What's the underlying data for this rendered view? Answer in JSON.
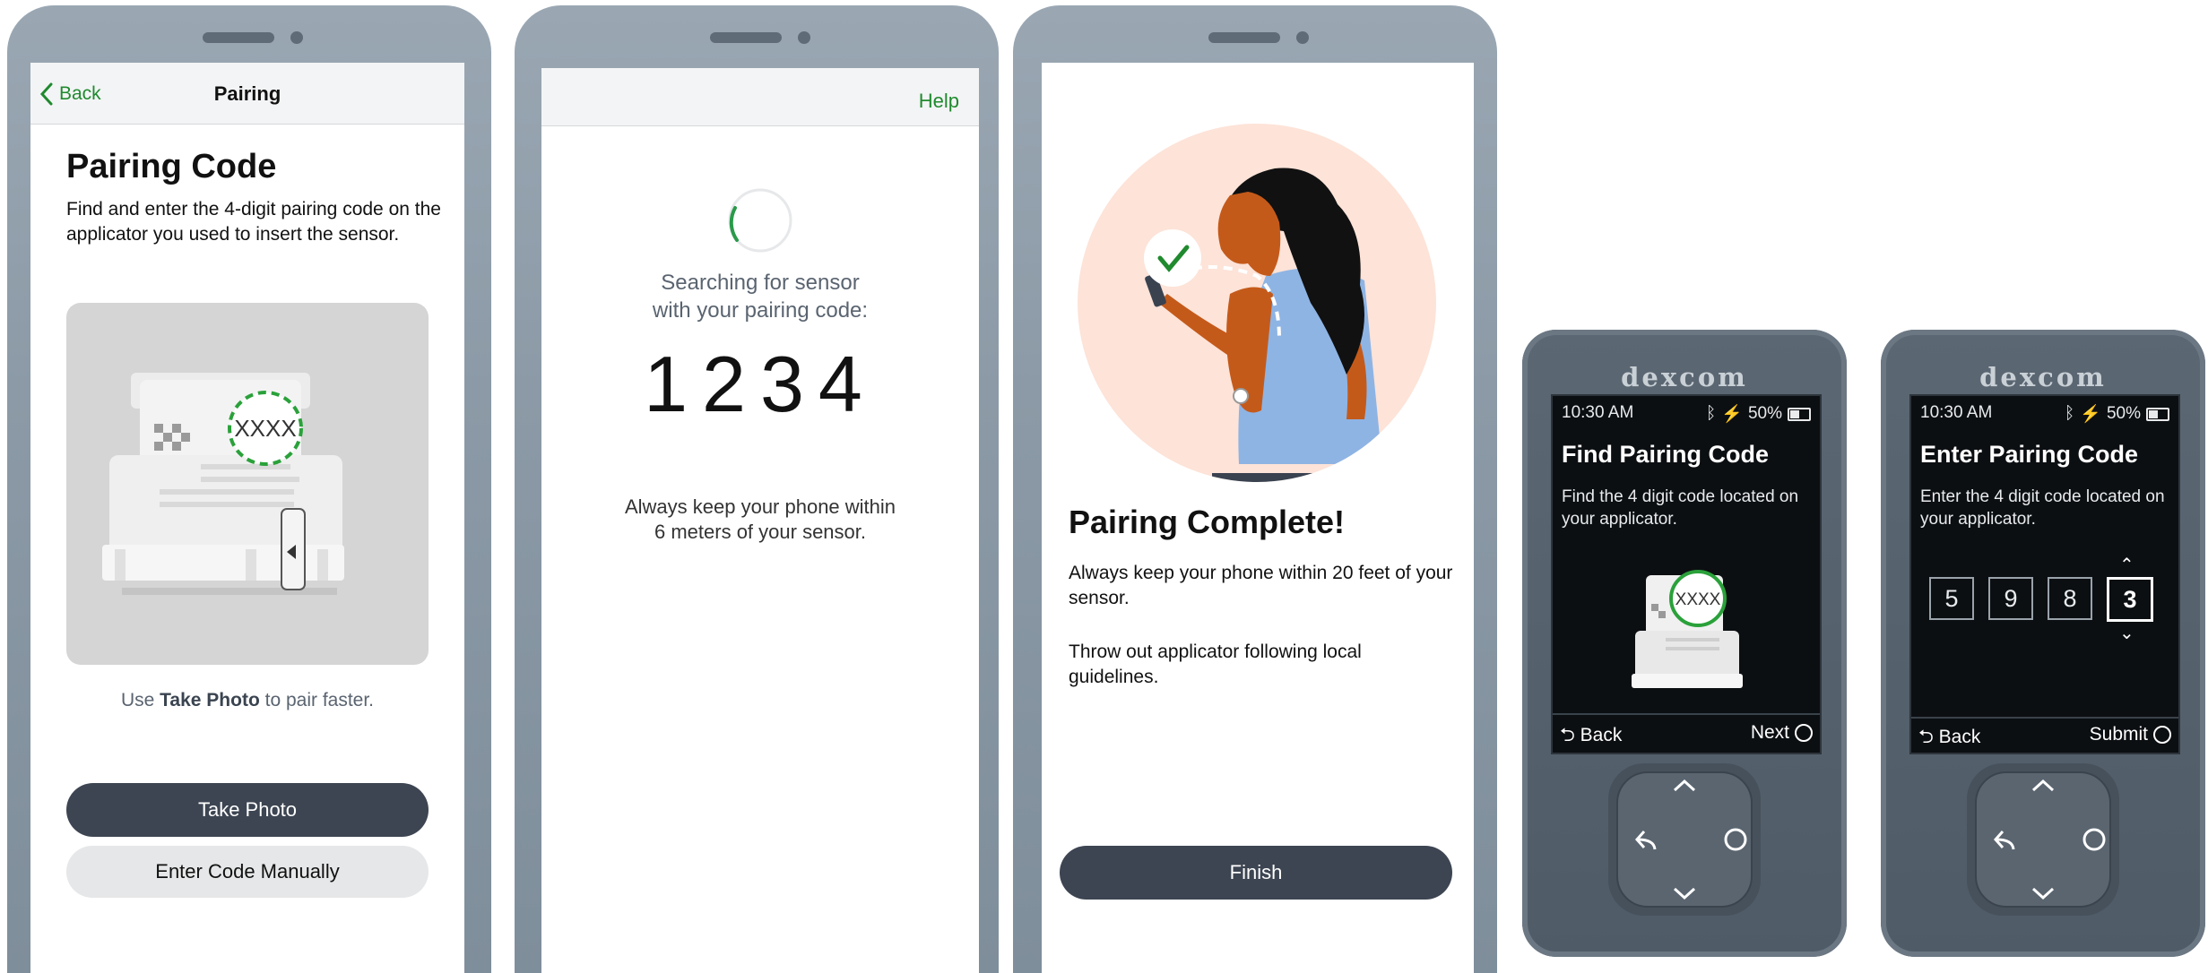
{
  "screen1": {
    "back_label": "Back",
    "nav_title": "Pairing",
    "heading": "Pairing Code",
    "body": "Find and enter the 4-digit pairing code on the applicator you used to insert the sensor.",
    "illustration_code": "XXXX",
    "hint_prefix": "Use ",
    "hint_bold": "Take Photo",
    "hint_suffix": " to pair faster.",
    "take_photo_label": "Take Photo",
    "enter_manually_label": "Enter Code Manually"
  },
  "screen2": {
    "help_label": "Help",
    "searching_line1": "Searching for sensor",
    "searching_line2": "with your pairing code:",
    "code": "1234",
    "keep_line1": "Always keep your phone within",
    "keep_line2": "6 meters of your sensor."
  },
  "screen3": {
    "title": "Pairing Complete!",
    "body1": "Always keep your phone within 20 feet of your sensor.",
    "body2": "Throw out applicator following local guidelines.",
    "finish_label": "Finish"
  },
  "receiver1": {
    "brand": "dexcom",
    "time": "10:30 AM",
    "battery": "50%",
    "title": "Find Pairing Code",
    "body": "Find the 4 digit code located on your applicator.",
    "illustration_code": "XXXX",
    "back_label": "Back",
    "next_label": "Next"
  },
  "receiver2": {
    "brand": "dexcom",
    "time": "10:30 AM",
    "battery": "50%",
    "title": "Enter Pairing Code",
    "body": "Enter the 4 digit code located on your applicator.",
    "digits": [
      "5",
      "9",
      "8",
      "3"
    ],
    "back_label": "Back",
    "submit_label": "Submit"
  },
  "colors": {
    "accent_green": "#1f8a2e",
    "button_dark": "#3d4552",
    "receiver_body": "#56626e"
  }
}
